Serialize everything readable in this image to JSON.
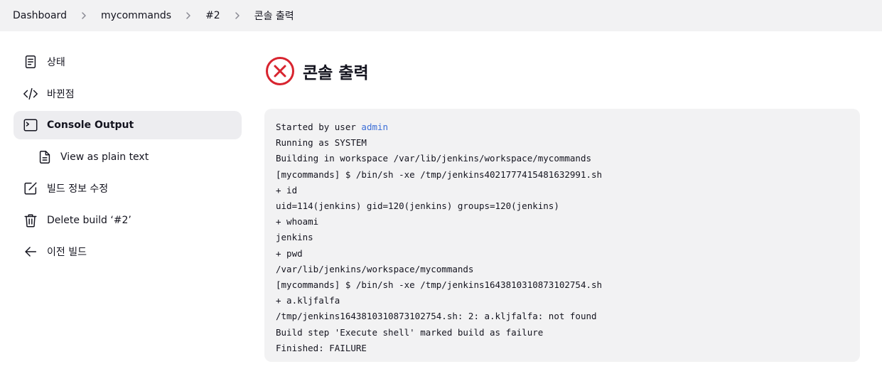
{
  "breadcrumb": {
    "items": [
      "Dashboard",
      "mycommands",
      "#2",
      "콘솔 출력"
    ]
  },
  "sidebar": {
    "items": [
      {
        "label": "상태",
        "icon": "document-icon"
      },
      {
        "label": "바뀐점",
        "icon": "code-icon"
      },
      {
        "label": "Console Output",
        "icon": "terminal-icon",
        "active": true
      },
      {
        "label": "View as plain text",
        "icon": "file-icon",
        "sub": true
      },
      {
        "label": "빌드 정보 수정",
        "icon": "edit-icon"
      },
      {
        "label": "Delete build ‘#2’",
        "icon": "trash-icon"
      },
      {
        "label": "이전 빌드",
        "icon": "arrow-left-icon"
      }
    ]
  },
  "main": {
    "title": "콘솔 출력",
    "status": "failure",
    "status_color": "#d8242f"
  },
  "console": {
    "started_prefix": "Started by user ",
    "user_link": "admin",
    "lines": [
      "Running as SYSTEM",
      "Building in workspace /var/lib/jenkins/workspace/mycommands",
      "[mycommands] $ /bin/sh -xe /tmp/jenkins4021777415481632991.sh",
      "+ id",
      "uid=114(jenkins) gid=120(jenkins) groups=120(jenkins)",
      "+ whoami",
      "jenkins",
      "+ pwd",
      "/var/lib/jenkins/workspace/mycommands",
      "[mycommands] $ /bin/sh -xe /tmp/jenkins1643810310873102754.sh",
      "+ a.kljfalfa",
      "/tmp/jenkins1643810310873102754.sh: 2: a.kljfalfa: not found",
      "Build step 'Execute shell' marked build as failure",
      "Finished: FAILURE"
    ]
  },
  "colors": {
    "link": "#3c6ed7",
    "failure": "#d8242f",
    "panel_bg": "#f2f2f3"
  }
}
